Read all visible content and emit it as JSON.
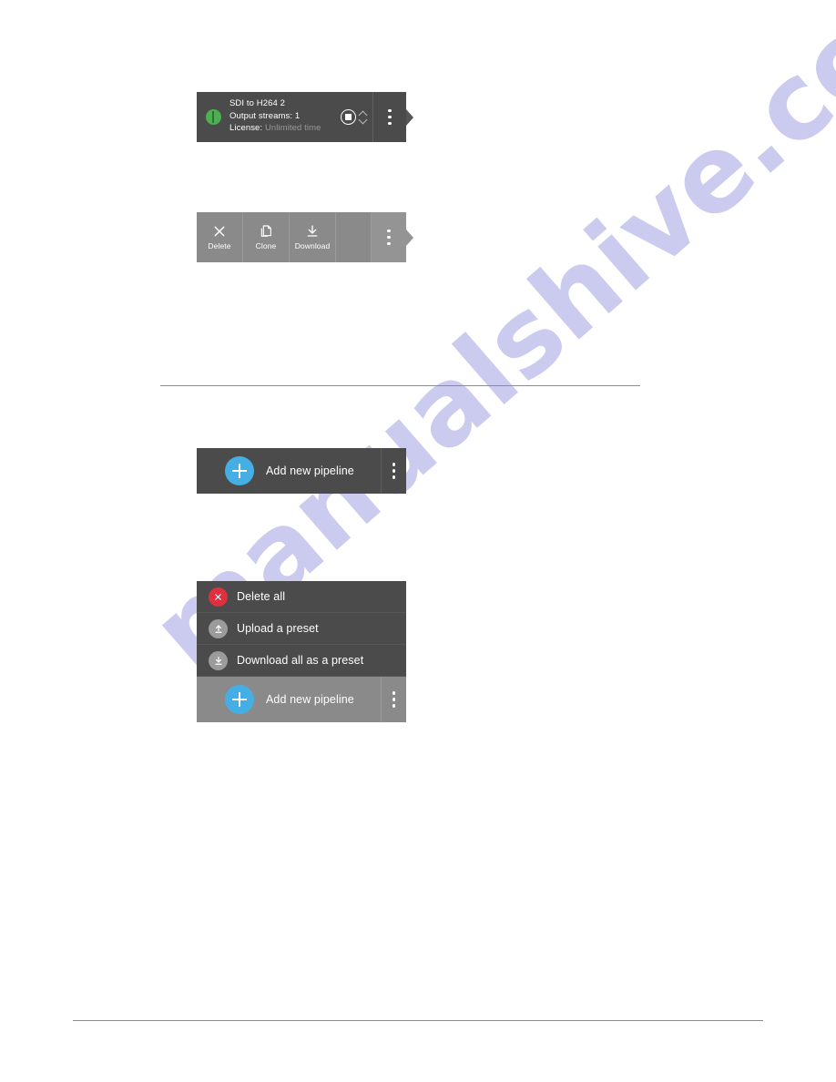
{
  "status_card": {
    "name": "SDI to H264 2",
    "output_streams": "Output streams: 1",
    "license_label": "License:",
    "license_value": "Unlimited time",
    "led_icon": "green-status-led-icon",
    "stop_icon": "stop-button-icon",
    "up_icon": "chevron-up-icon",
    "down_icon": "chevron-down-icon",
    "kebab_icon": "kebab-menu-icon",
    "arrow_icon": "arrow-right-tab-icon",
    "led_color": "#4caf50"
  },
  "toolbar": {
    "items": [
      {
        "label": "Delete",
        "icon": "close-x-icon"
      },
      {
        "label": "Clone",
        "icon": "copy-duplicate-icon"
      },
      {
        "label": "Download",
        "icon": "download-arrow-icon"
      }
    ],
    "kebab_icon": "kebab-menu-icon",
    "arrow_icon": "arrow-right-tab-icon"
  },
  "add_bar": {
    "label": "Add new pipeline",
    "plus_icon": "plus-circle-icon",
    "kebab_icon": "kebab-menu-icon",
    "accent_color": "#45aee5"
  },
  "menu": {
    "items": [
      {
        "label": "Delete all",
        "icon": "delete-x-circle-icon",
        "color": "#e0303f"
      },
      {
        "label": "Upload a preset",
        "icon": "upload-arrow-circle-icon",
        "color": "#9b9b9b"
      },
      {
        "label": "Download all as a preset",
        "icon": "download-arrow-circle-icon",
        "color": "#9b9b9b"
      }
    ],
    "footer": {
      "label": "Add new pipeline",
      "plus_icon": "plus-circle-icon",
      "kebab_icon": "kebab-menu-icon"
    }
  },
  "watermark": {
    "text": "manualshive.com"
  }
}
